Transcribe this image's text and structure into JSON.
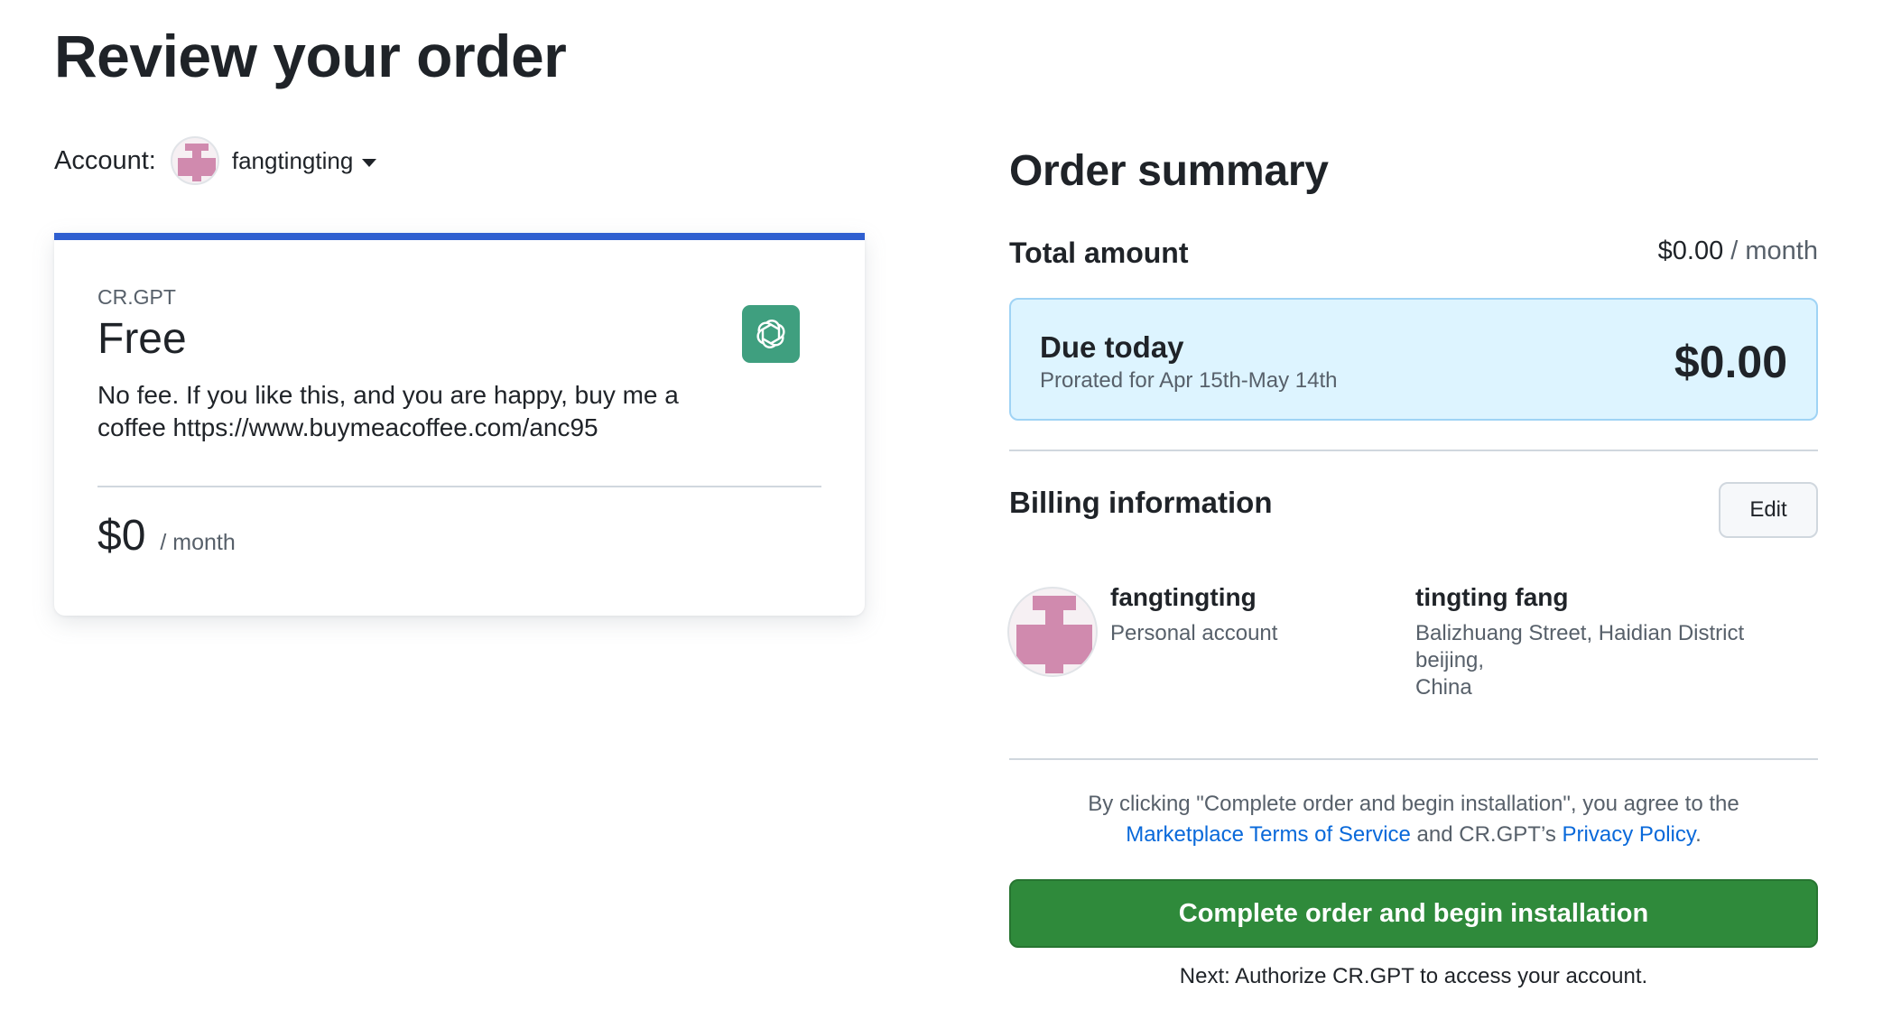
{
  "page": {
    "title": "Review your order"
  },
  "account": {
    "label": "Account:",
    "username": "fangtingting",
    "avatar_color": "#d08aae"
  },
  "plan": {
    "vendor": "CR.GPT",
    "name": "Free",
    "description": "No fee. If you like this, and you are happy, buy me a coffee https://www.buymeacoffee.com/anc95",
    "price": "$0",
    "period": "/ month",
    "accent_color": "#2f5fd0",
    "logo_icon": "openai-logo-icon",
    "logo_bg": "#3f9f7f"
  },
  "summary": {
    "title": "Order summary",
    "total_label": "Total amount",
    "total_value": "$0.00",
    "total_period": " / month",
    "due_label": "Due today",
    "due_sub": "Prorated for Apr 15th-May 14th",
    "due_amount": "$0.00"
  },
  "billing": {
    "title": "Billing information",
    "edit_label": "Edit",
    "user_name": "fangtingting",
    "user_type": "Personal account",
    "contact_name": "tingting fang",
    "address_line1": "Balizhuang Street, Haidian District",
    "address_line2": "beijing,",
    "address_line3": "China"
  },
  "terms": {
    "prefix": "By clicking \"Complete order and begin installation\", you agree to the",
    "tos_link": "Marketplace Terms of Service",
    "middle": " and CR.GPT’s ",
    "privacy_link": "Privacy Policy",
    "suffix": "."
  },
  "actions": {
    "complete_label": "Complete order and begin installation",
    "complete_color": "#2f8a3b",
    "next_note": "Next: Authorize CR.GPT to access your account."
  }
}
